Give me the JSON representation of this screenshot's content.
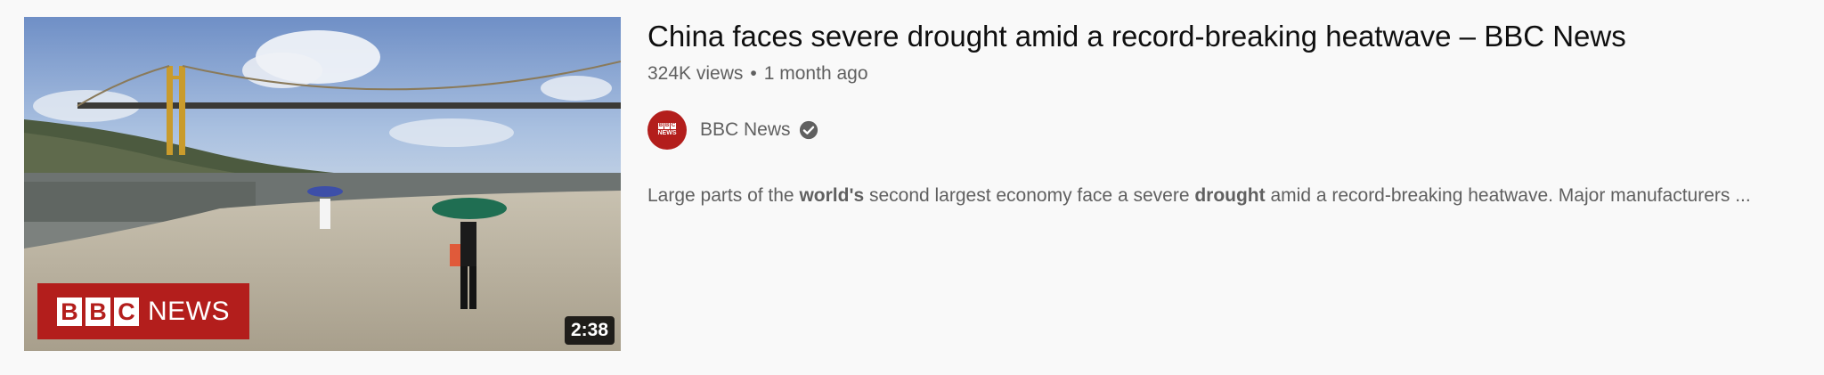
{
  "video": {
    "title": "China faces severe drought amid a record-breaking heatwave – BBC News",
    "views": "324K views",
    "separator": "•",
    "uploaded": "1 month ago",
    "duration": "2:38",
    "thumbnail_logo": {
      "blocks": [
        "B",
        "B",
        "C"
      ],
      "word": "NEWS"
    }
  },
  "channel": {
    "name": "BBC News",
    "avatar_blocks": [
      "B",
      "B",
      "C"
    ],
    "avatar_word": "NEWS",
    "verified_icon": "verified-check-icon"
  },
  "description": {
    "parts": [
      {
        "text": "Large parts of the ",
        "bold": false
      },
      {
        "text": "world's",
        "bold": true
      },
      {
        "text": " second largest economy face a severe ",
        "bold": false
      },
      {
        "text": "drought",
        "bold": true
      },
      {
        "text": " amid a record-breaking heatwave. Major manufacturers ...",
        "bold": false
      }
    ]
  },
  "colors": {
    "bbc_red": "#b31e1c",
    "title_text": "#0f0f0f",
    "secondary_text": "#606060",
    "background": "#f9f9f9"
  }
}
